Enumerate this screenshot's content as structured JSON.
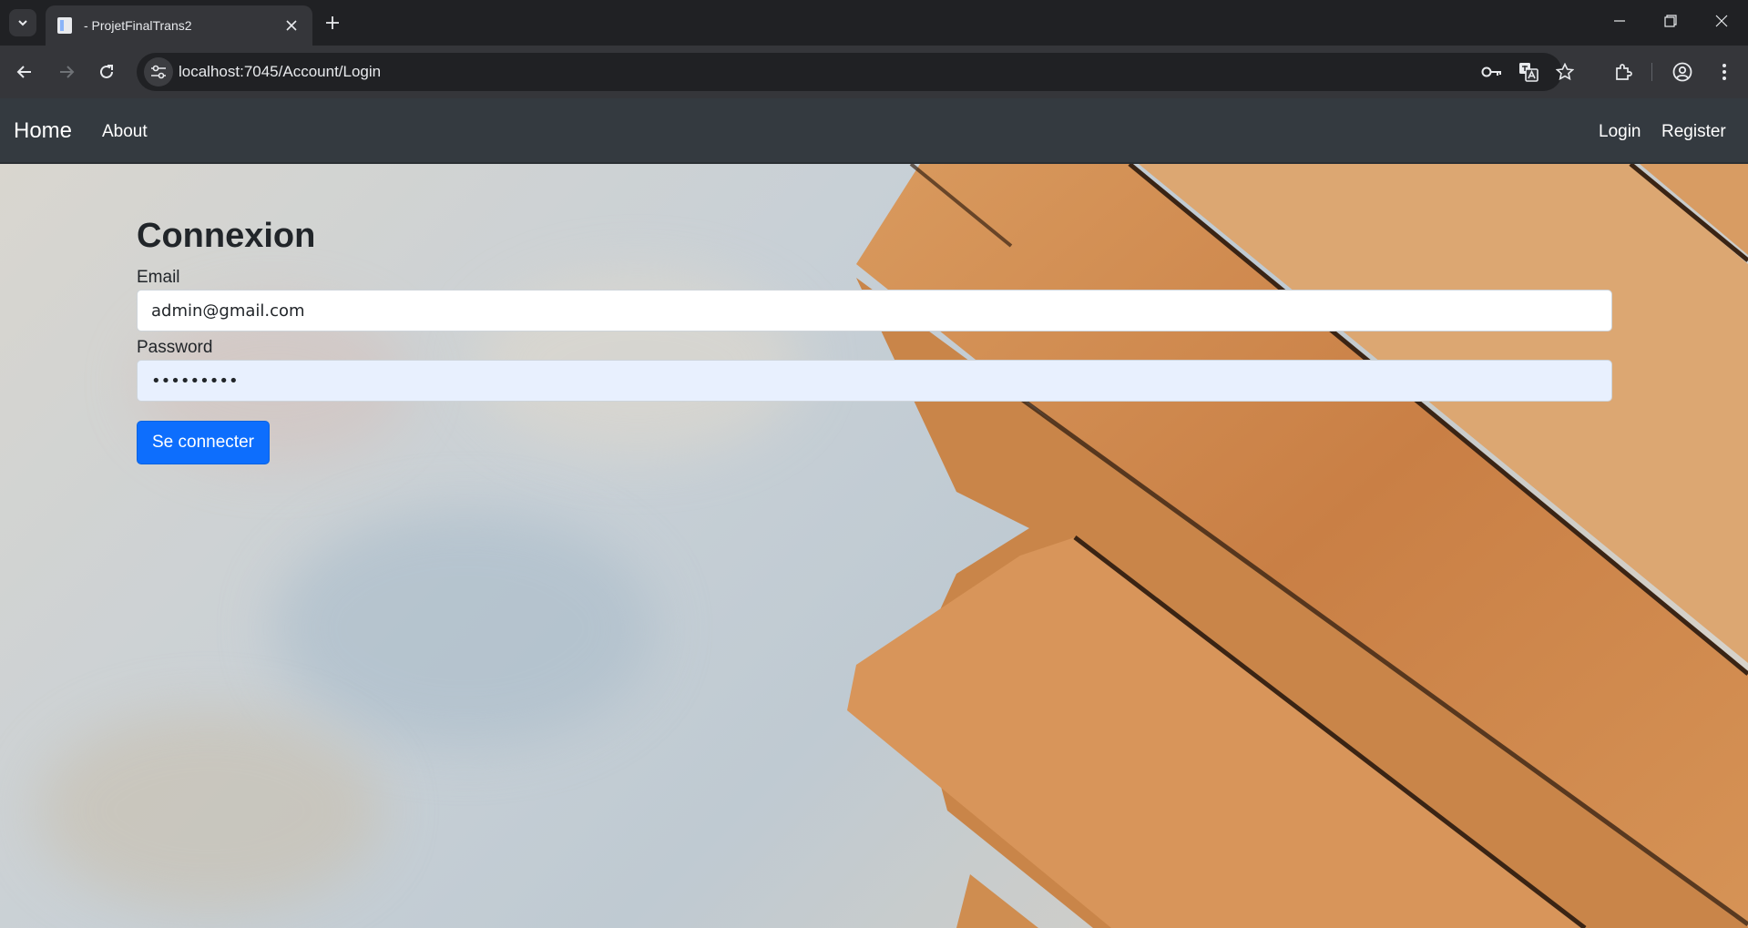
{
  "browser": {
    "tab_title": "- ProjetFinalTrans2",
    "url": "localhost:7045/Account/Login"
  },
  "navbar": {
    "brand": "Home",
    "about": "About",
    "login": "Login",
    "register": "Register"
  },
  "form": {
    "heading": "Connexion",
    "email_label": "Email",
    "email_value": "admin@gmail.com",
    "password_label": "Password",
    "password_value": "•••••••••",
    "submit_label": "Se connecter"
  },
  "colors": {
    "navbar_bg": "#343a40",
    "button_primary": "#0d6efd",
    "autofill_bg": "#e8f0fe"
  }
}
